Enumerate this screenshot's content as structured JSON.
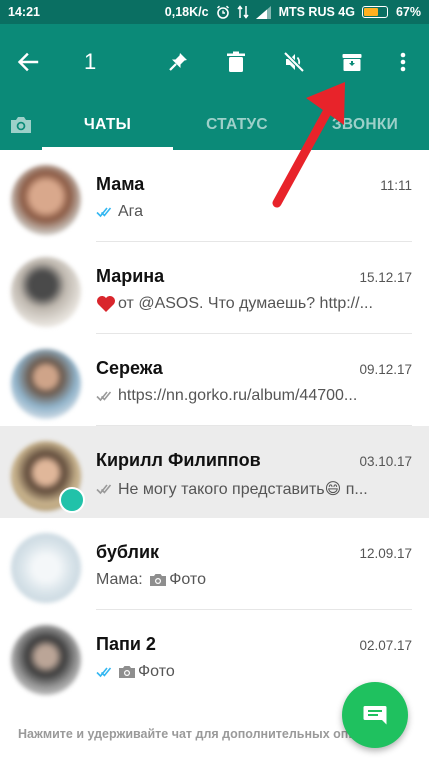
{
  "statusbar": {
    "time": "14:21",
    "speed": "0,18K/c",
    "carrier": "MTS RUS 4G",
    "battery": "67%",
    "battery_level": 0.67
  },
  "actionbar": {
    "selected_count": "1",
    "icons": [
      "back-arrow-icon",
      "pin-icon",
      "delete-icon",
      "mute-icon",
      "archive-icon",
      "more-icon"
    ]
  },
  "tabs": [
    {
      "label": ""
    },
    {
      "label": "ЧАТЫ",
      "active": true
    },
    {
      "label": "СТАТУС"
    },
    {
      "label": "ЗВОНКИ"
    }
  ],
  "chats": [
    {
      "name": "Мама",
      "date": "11:11",
      "preview": "Ага",
      "ticks": "read",
      "photo": false,
      "heart": false
    },
    {
      "name": "Марина",
      "date": "15.12.17",
      "preview": "от @ASOS. Что думаешь? http://...",
      "ticks": "none",
      "heart": true
    },
    {
      "name": "Сережа",
      "date": "09.12.17",
      "preview": "https://nn.gorko.ru/album/44700...",
      "ticks": "delivered"
    },
    {
      "name": "Кирилл Филиппов",
      "date": "03.10.17",
      "preview": "Не могу такого представить😄 п...",
      "ticks": "delivered",
      "selected": true
    },
    {
      "name": "бублик",
      "date": "12.09.17",
      "preview_prefix": "Мама: ",
      "preview": "Фото",
      "photo": true
    },
    {
      "name": "Папи 2",
      "date": "02.07.17",
      "preview": "Фото",
      "ticks": "read",
      "photo": true
    }
  ],
  "hint": "Нажмите и удерживайте чат для дополнительных опций",
  "colors": {
    "header": "#0b8a78",
    "statusbar": "#0a6f62",
    "fab": "#1fc15f",
    "read_ticks": "#34b7f1",
    "arrow": "#e8232a"
  }
}
